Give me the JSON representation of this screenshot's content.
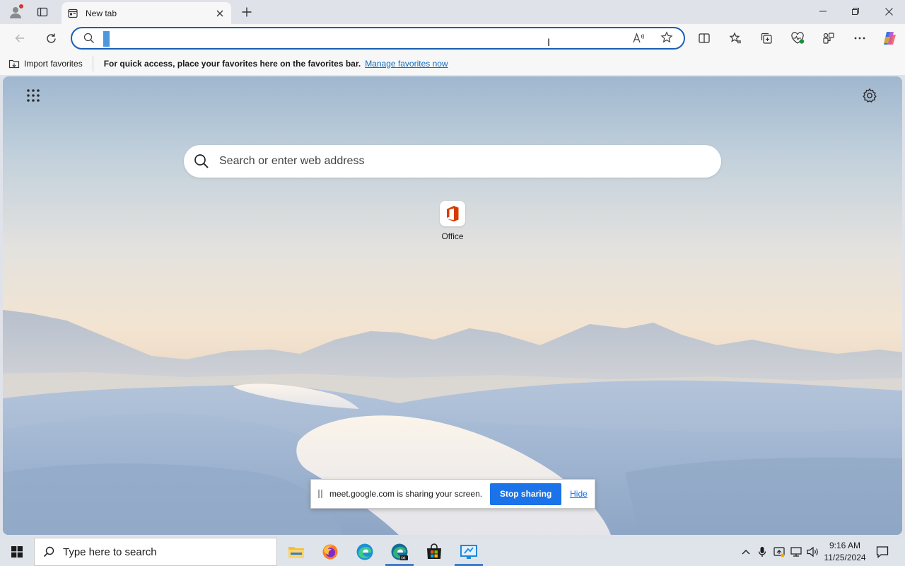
{
  "browser": {
    "tab": {
      "title": "New tab"
    },
    "address_bar": {
      "value": "",
      "placeholder": ""
    }
  },
  "favorites_bar": {
    "import_label": "Import favorites",
    "message": "For quick access, place your favorites here on the favorites bar.",
    "manage_link": "Manage favorites now"
  },
  "new_tab_page": {
    "search_placeholder": "Search or enter web address",
    "quick_links": [
      {
        "label": "Office"
      }
    ]
  },
  "screen_share_bar": {
    "message": "meet.google.com is sharing your screen.",
    "stop_label": "Stop sharing",
    "hide_label": "Hide"
  },
  "taskbar": {
    "search_placeholder": "Type here to search",
    "apps": [
      "file-explorer",
      "firefox",
      "edge",
      "edge-dev",
      "microsoft-store",
      "remote-desktop"
    ],
    "clock": {
      "time": "9:16 AM",
      "date": "11/25/2024"
    }
  },
  "colors": {
    "accent": "#1a5fb4",
    "share_button": "#1a73e8",
    "link": "#0f6cbd",
    "office_red": "#d83b01"
  }
}
